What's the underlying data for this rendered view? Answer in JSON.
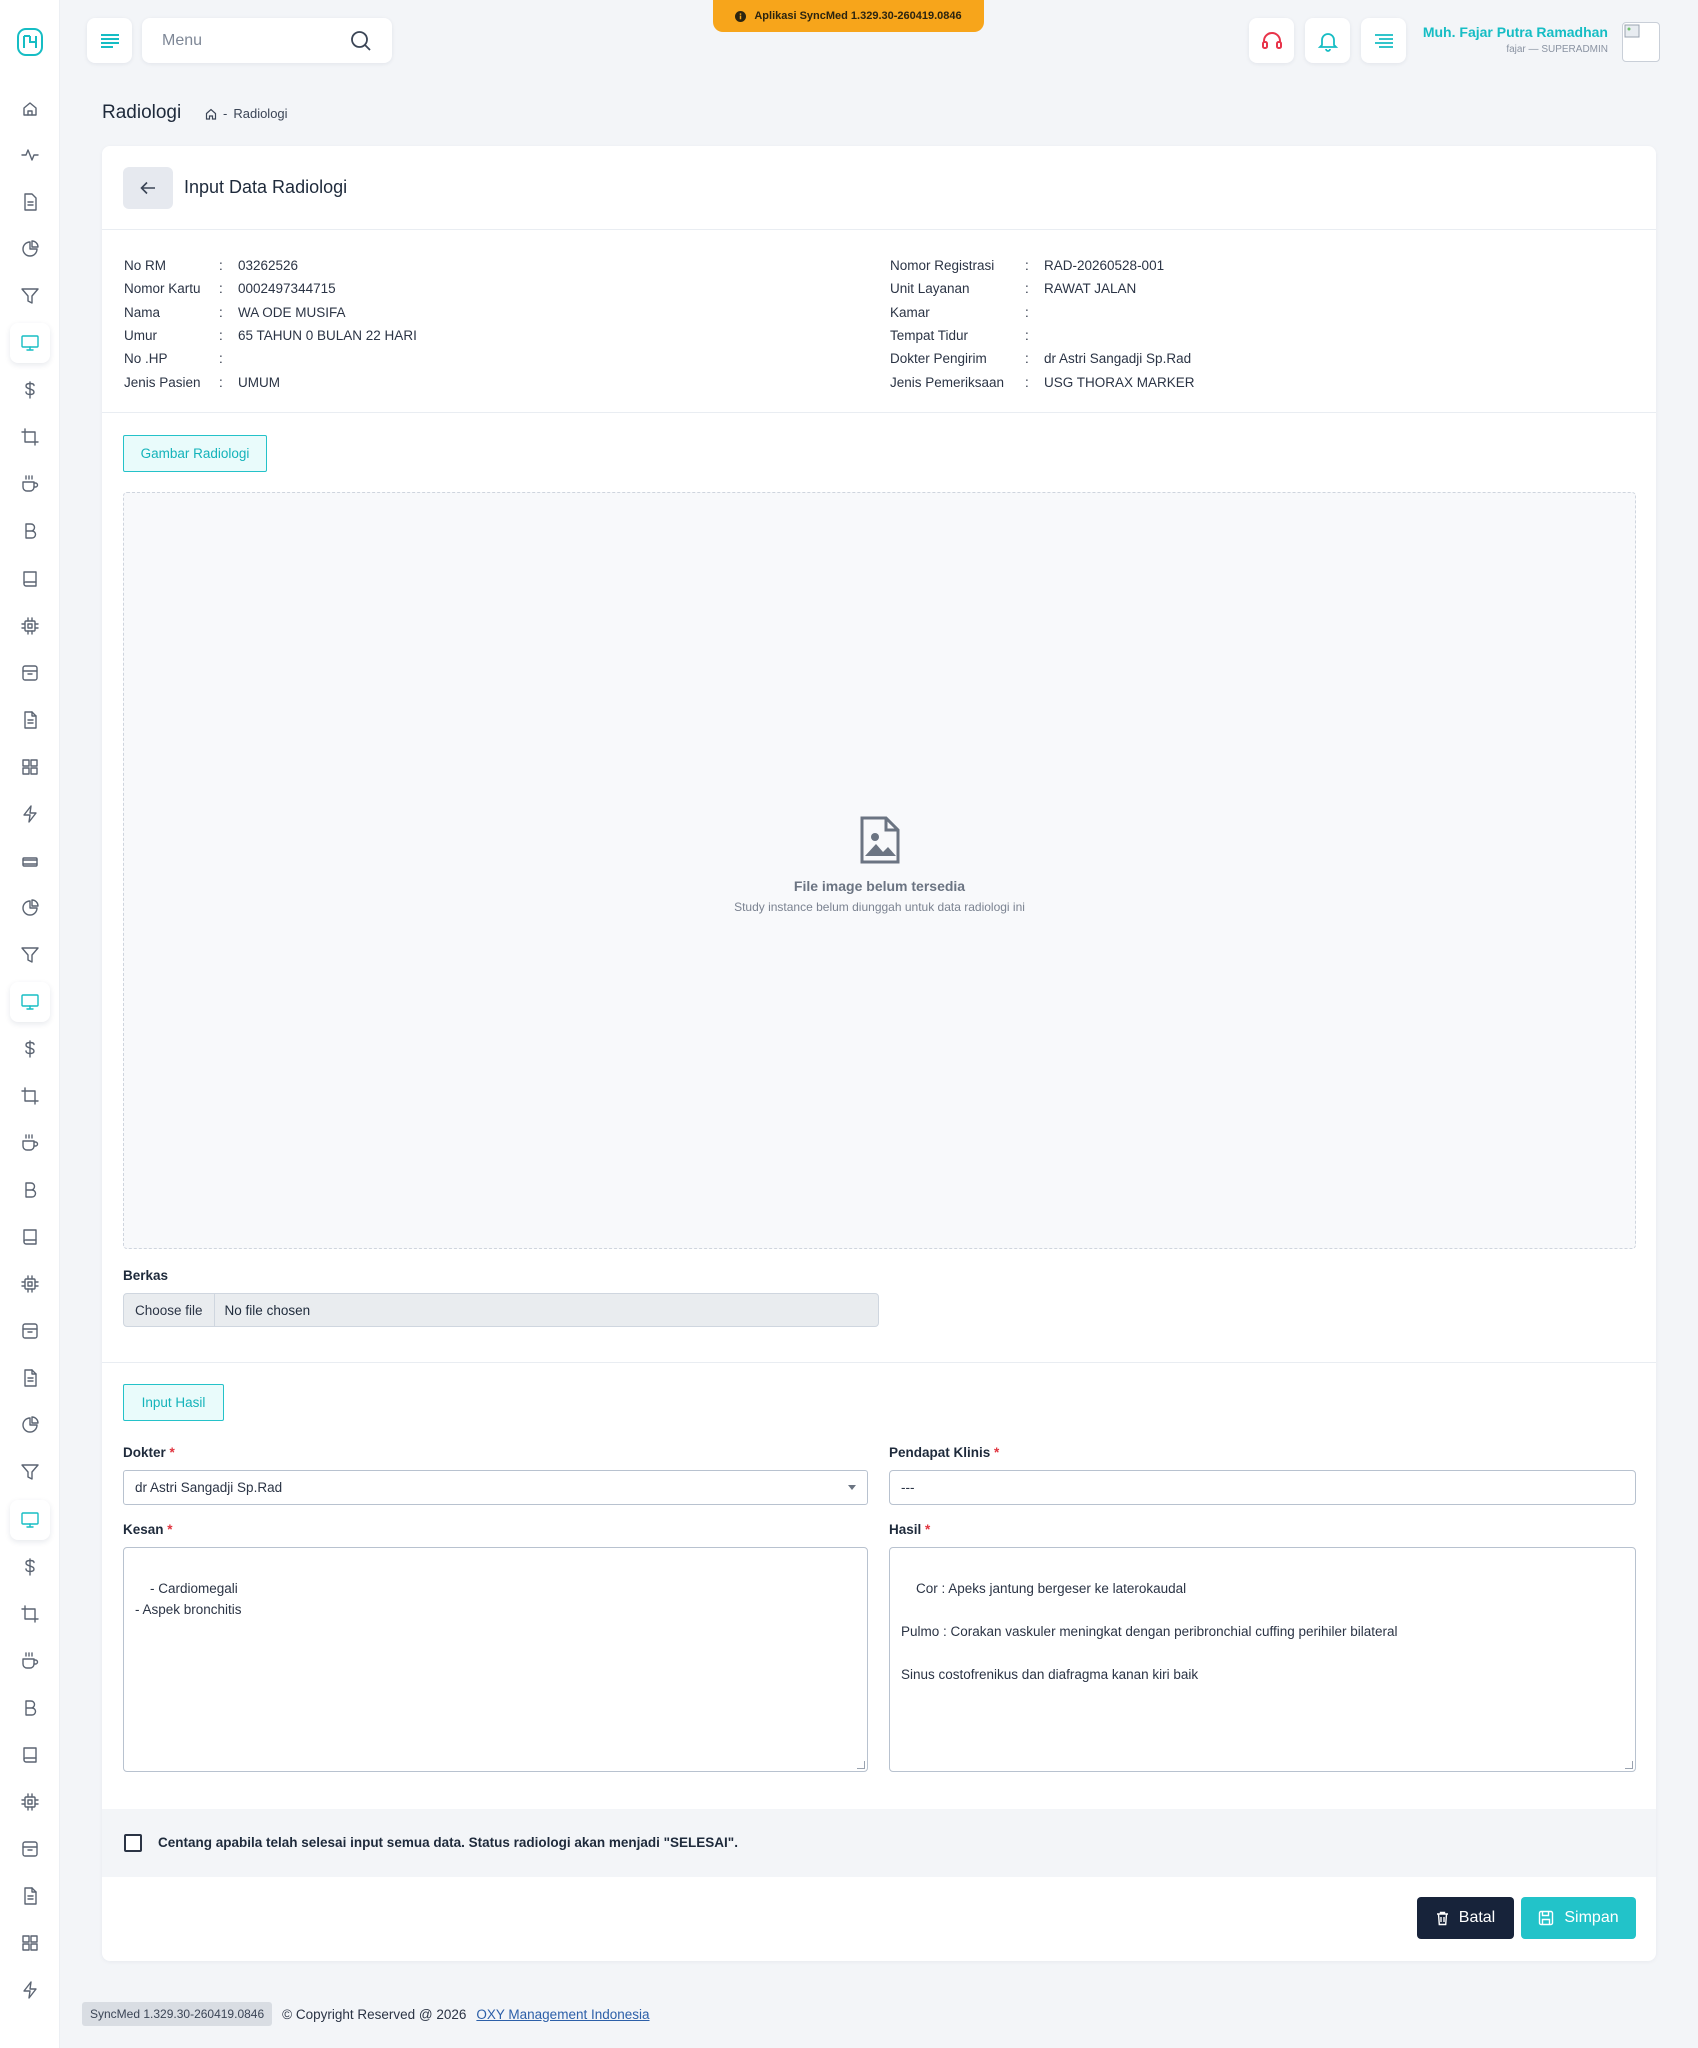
{
  "topbar": {
    "search_placeholder": "Menu",
    "version_banner": "Aplikasi SyncMed 1.329.30-260419.0846",
    "user_name": "Muh. Fajar Putra Ramadhan",
    "user_role": "fajar — SUPERADMIN"
  },
  "sidebar": {
    "icons": [
      "home-icon",
      "activity-icon",
      "file-icon",
      "pie-chart-icon",
      "filter-icon",
      "monitor-icon",
      "dollar-icon",
      "crop-icon",
      "coffee-icon",
      "bold-icon",
      "book-icon",
      "cpu-icon",
      "archive-icon",
      "file-text-icon",
      "grid-icon",
      "zap-icon",
      "layers-icon",
      "pie-chart-icon",
      "filter-icon",
      "monitor-icon",
      "dollar-icon",
      "crop-icon",
      "coffee-icon",
      "bold-icon",
      "book-icon",
      "cpu-icon",
      "archive-icon",
      "file-text-icon",
      "pie-chart-icon",
      "filter-icon",
      "monitor-icon",
      "dollar-icon",
      "crop-icon",
      "coffee-icon",
      "bold-icon",
      "book-icon",
      "cpu-icon",
      "archive-icon",
      "file-text-icon",
      "grid-icon",
      "zap-icon"
    ],
    "accent": "#16bdc4"
  },
  "page": {
    "title": "Radiologi",
    "breadcrumb": "Radiologi",
    "breadcrumb_sep": "-"
  },
  "card": {
    "title": "Input Data Radiologi"
  },
  "patient_left": [
    {
      "label": "No RM",
      "value": "03262526"
    },
    {
      "label": "Nomor Kartu",
      "value": "0002497344715"
    },
    {
      "label": "Nama",
      "value": "WA ODE MUSIFA"
    },
    {
      "label": "Umur",
      "value": "65 TAHUN 0 BULAN 22 HARI"
    },
    {
      "label": "No .HP",
      "value": ""
    },
    {
      "label": "Jenis Pasien",
      "value": "UMUM"
    }
  ],
  "patient_right": [
    {
      "label": "Nomor Registrasi",
      "value": "RAD-20260528-001"
    },
    {
      "label": "Unit Layanan",
      "value": "RAWAT JALAN"
    },
    {
      "label": "Kamar",
      "value": ""
    },
    {
      "label": "Tempat Tidur",
      "value": ""
    },
    {
      "label": "Dokter Pengirim",
      "value": "dr Astri Sangadji Sp.Rad"
    },
    {
      "label": "Jenis Pemeriksaan",
      "value": "USG THORAX MARKER"
    }
  ],
  "colon": ":",
  "image_section": {
    "tab_label": "Gambar Radiologi",
    "empty_title": "File image belum tersedia",
    "empty_subtitle": "Study instance belum diunggah untuk data radiologi ini",
    "berkas_label": "Berkas",
    "choose_file": "Choose file",
    "no_file": "No file chosen"
  },
  "result_section": {
    "tab_label": "Input Hasil",
    "dokter_label": "Dokter",
    "dokter_value": "dr Astri Sangadji Sp.Rad",
    "pendapat_label": "Pendapat Klinis",
    "pendapat_value": "---",
    "kesan_label": "Kesan",
    "kesan_value": "- Cardiomegali\n- Aspek bronchitis",
    "hasil_label": "Hasil",
    "hasil_value": "Cor : Apeks jantung bergeser ke laterokaudal\n\nPulmo : Corakan vaskuler meningkat dengan peribronchial cuffing perihiler bilateral\n\nSinus costofrenikus dan diafragma kanan kiri baik",
    "required_mark": "*"
  },
  "confirm": {
    "text": "Centang apabila telah selesai input semua data. Status radiologi akan menjadi \"SELESAI\"."
  },
  "actions": {
    "cancel": "Batal",
    "save": "Simpan"
  },
  "footer": {
    "version": "SyncMed 1.329.30-260419.0846",
    "copyright": "© Copyright Reserved @ 2026",
    "company": "OXY Management Indonesia"
  }
}
